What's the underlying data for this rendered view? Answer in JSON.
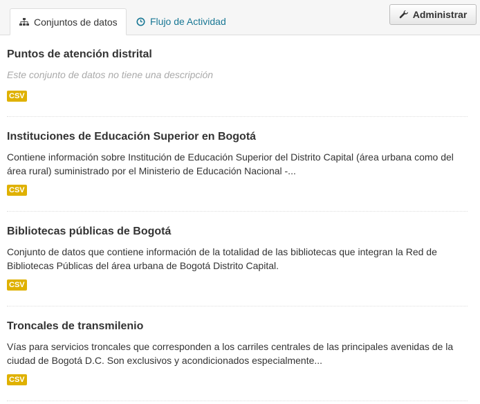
{
  "tabs": {
    "datasets_label": "Conjuntos de datos",
    "activity_label": "Flujo de Actividad"
  },
  "toolbar": {
    "admin_label": "Administrar"
  },
  "datasets": [
    {
      "title": "Puntos de atención distrital",
      "description": "Este conjunto de datos no tiene una descripción",
      "format": "CSV"
    },
    {
      "title": "Instituciones de Educación Superior en Bogotá",
      "description": "Contiene información sobre Institución de Educación Superior del Distrito Capital (área urbana como del área rural) suministrado por el Ministerio de Educación Nacional -...",
      "format": "CSV"
    },
    {
      "title": "Bibliotecas públicas de Bogotá",
      "description": "Conjunto de datos que contiene información de la totalidad de las bibliotecas que integran la Red de Bibliotecas Públicas del área urbana de Bogotá Distrito Capital.",
      "format": "CSV"
    },
    {
      "title": "Troncales de transmilenio",
      "description": "Vías para servicios troncales que corresponden a los carriles centrales de las principales avenidas de la ciudad de Bogotá D.C. Son exclusivos y acondicionados especialmente...",
      "format": "CSV"
    }
  ],
  "icons": {
    "datasets_tab": "sitemap-icon",
    "activity_tab": "clock-icon",
    "admin": "wrench-icon"
  },
  "colors": {
    "link": "#187794",
    "badge": "#dfb100",
    "muted": "#aaaaaa"
  }
}
